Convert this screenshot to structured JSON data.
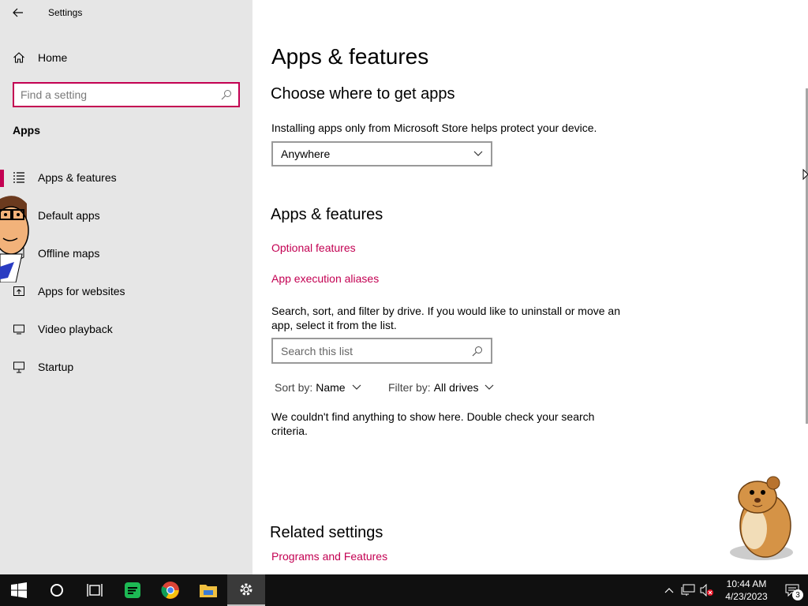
{
  "app": {
    "title": "Settings"
  },
  "sidebar": {
    "home_label": "Home",
    "search_placeholder": "Find a setting",
    "section_label": "Apps",
    "items": [
      {
        "label": "Apps & features",
        "icon": "list-icon",
        "selected": true
      },
      {
        "label": "Default apps",
        "icon": "default-apps-icon"
      },
      {
        "label": "Offline maps",
        "icon": "map-icon"
      },
      {
        "label": "Apps for websites",
        "icon": "open-in-app-icon"
      },
      {
        "label": "Video playback",
        "icon": "video-icon"
      },
      {
        "label": "Startup",
        "icon": "startup-icon"
      }
    ]
  },
  "main": {
    "page_title": "Apps & features",
    "choose_heading": "Choose where to get apps",
    "choose_desc": "Installing apps only from Microsoft Store helps protect your device.",
    "source_dropdown_value": "Anywhere",
    "features_heading": "Apps & features",
    "optional_features_link": "Optional features",
    "aliases_link": "App execution aliases",
    "search_desc": "Search, sort, and filter by drive. If you would like to uninstall or move an app, select it from the list.",
    "list_search_placeholder": "Search this list",
    "sort_label": "Sort by:",
    "sort_value": "Name",
    "filter_label": "Filter by:",
    "filter_value": "All drives",
    "empty_message": "We couldn't find anything to show here. Double check your search criteria.",
    "related_heading": "Related settings",
    "programs_link": "Programs and Features"
  },
  "taskbar": {
    "time": "10:44 AM",
    "date": "4/23/2023",
    "notification_count": "3",
    "apps": [
      "windows-start-icon",
      "cortana-icon",
      "task-view-icon",
      "spotify-icon",
      "chrome-icon",
      "file-explorer-icon",
      "settings-icon"
    ]
  },
  "colors": {
    "accent": "#c30052",
    "sidebar_bg": "#e6e6e6",
    "taskbar_bg": "#101010"
  }
}
